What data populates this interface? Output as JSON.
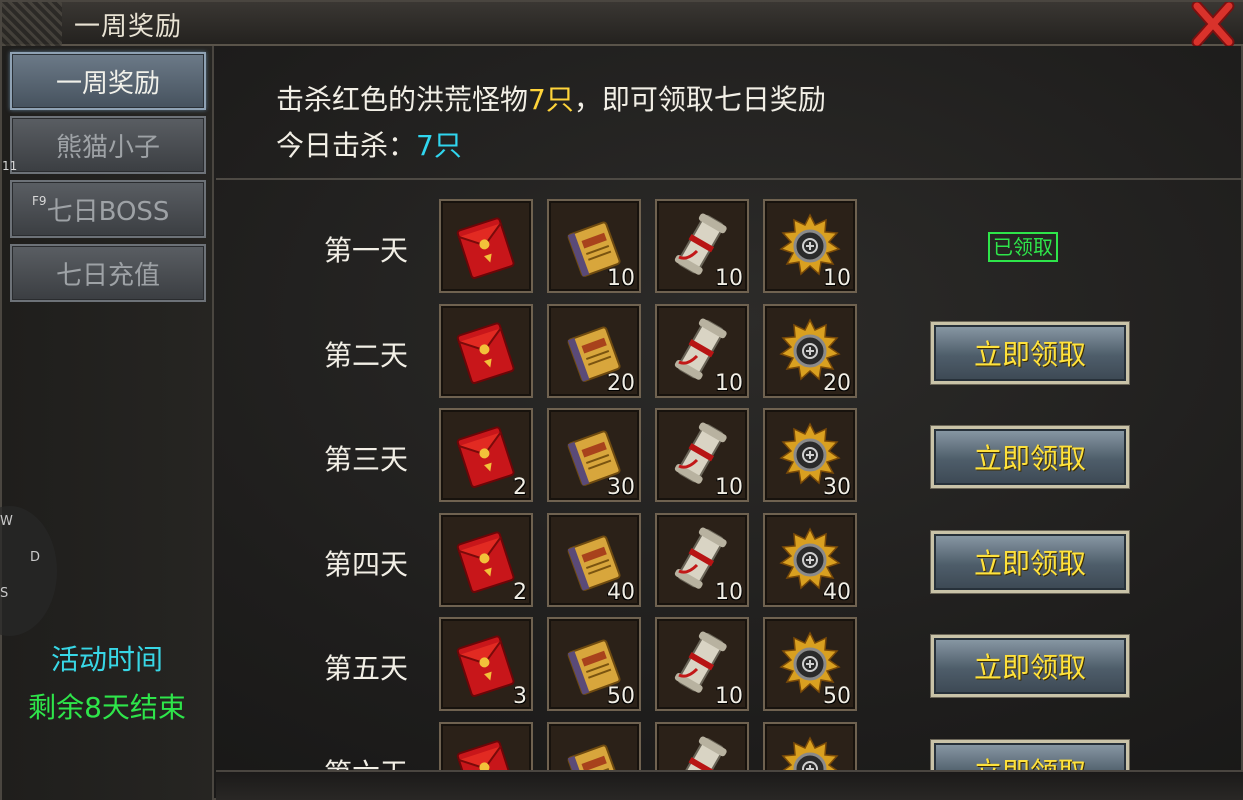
{
  "window": {
    "title": "一周奖励",
    "close_icon": "close-x-icon"
  },
  "sidebar": {
    "tabs": [
      {
        "label": "一周奖励",
        "active": true
      },
      {
        "label": "熊猫小子",
        "active": false,
        "hotkey": "11"
      },
      {
        "label": "七日BOSS",
        "active": false,
        "hotkey": "F9"
      },
      {
        "label": "七日充值",
        "active": false
      }
    ],
    "compass": {
      "w": "W",
      "d": "D",
      "s": "S"
    },
    "event_time_label": "活动时间",
    "event_remaining": "剩余8天结束"
  },
  "main": {
    "desc_prefix": "击杀红色的洪荒怪物",
    "desc_count": "7只",
    "desc_suffix": "，即可领取七日奖励",
    "kills_label": "今日击杀：",
    "kills_value": "7只",
    "rows": [
      {
        "day": "第一天",
        "qty": [
          "",
          "10",
          "10",
          "10"
        ],
        "status": "已领取"
      },
      {
        "day": "第二天",
        "qty": [
          "",
          "20",
          "10",
          "20"
        ],
        "button": "立即领取"
      },
      {
        "day": "第三天",
        "qty": [
          "2",
          "30",
          "10",
          "30"
        ],
        "button": "立即领取"
      },
      {
        "day": "第四天",
        "qty": [
          "2",
          "40",
          "10",
          "40"
        ],
        "button": "立即领取"
      },
      {
        "day": "第五天",
        "qty": [
          "3",
          "50",
          "10",
          "50"
        ],
        "button": "立即领取"
      },
      {
        "day": "第六天",
        "qty": [
          "",
          "",
          "",
          ""
        ],
        "button": "立即领取"
      }
    ],
    "item_icons": [
      "red-envelope-icon",
      "golden-book-icon",
      "scroll-icon",
      "gear-medallion-icon"
    ]
  },
  "colors": {
    "highlight_yellow": "#ffd43a",
    "highlight_cyan": "#30d6ef",
    "claimed_green": "#2ee54a",
    "button_text": "#ffe23c"
  }
}
